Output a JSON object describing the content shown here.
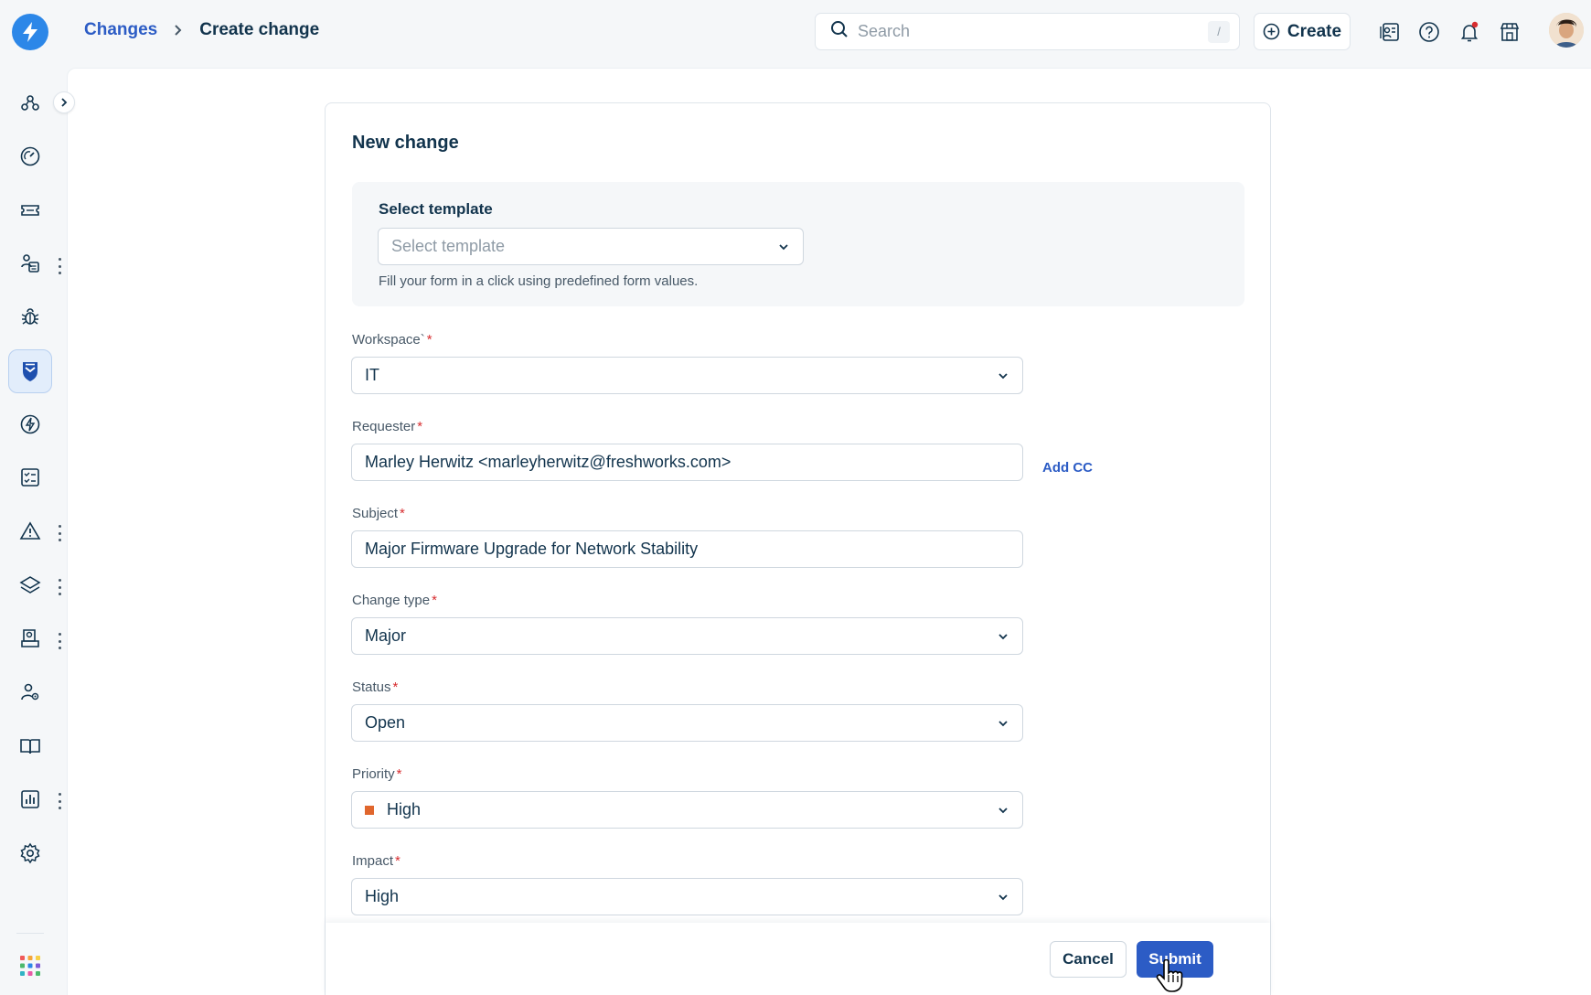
{
  "header": {
    "breadcrumb": {
      "parent": "Changes",
      "current": "Create change"
    },
    "search": {
      "placeholder": "Search",
      "shortcut": "/"
    },
    "create_label": "Create",
    "icons": [
      "contacts-icon",
      "help-icon",
      "notifications-icon",
      "marketplace-icon"
    ]
  },
  "sidebar": {
    "items": [
      {
        "name": "agents-icon"
      },
      {
        "name": "dashboard-icon"
      },
      {
        "name": "tickets-icon"
      },
      {
        "name": "assets-icon",
        "has_menu": true
      },
      {
        "name": "problems-icon"
      },
      {
        "name": "changes-icon",
        "active": true
      },
      {
        "name": "releases-icon"
      },
      {
        "name": "tasks-icon"
      },
      {
        "name": "alerts-icon",
        "has_menu": true
      },
      {
        "name": "projects-icon",
        "has_menu": true
      },
      {
        "name": "contracts-icon",
        "has_menu": true
      },
      {
        "name": "admin-users-icon"
      },
      {
        "name": "solutions-icon"
      },
      {
        "name": "analytics-icon",
        "has_menu": true
      },
      {
        "name": "settings-icon"
      }
    ]
  },
  "form": {
    "title": "New change",
    "template": {
      "label": "Select template",
      "placeholder": "Select template",
      "hint": "Fill your form in a click using predefined form values."
    },
    "workspace": {
      "label": "Workspace`",
      "value": "IT"
    },
    "requester": {
      "label": "Requester",
      "value": "Marley Herwitz <marleyherwitz@freshworks.com>",
      "add_cc": "Add CC"
    },
    "subject": {
      "label": "Subject",
      "value": "Major Firmware Upgrade for Network Stability"
    },
    "change_type": {
      "label": "Change type",
      "value": "Major"
    },
    "status": {
      "label": "Status",
      "value": "Open"
    },
    "priority": {
      "label": "Priority",
      "value": "High",
      "color": "#e0662d"
    },
    "impact": {
      "label": "Impact",
      "value": "High"
    },
    "required_mark": "*"
  },
  "footer": {
    "cancel_label": "Cancel",
    "submit_label": "Submit"
  },
  "colors": {
    "brand": "#2c87e8",
    "primary": "#2c5cc5",
    "required": "#d72d30"
  }
}
